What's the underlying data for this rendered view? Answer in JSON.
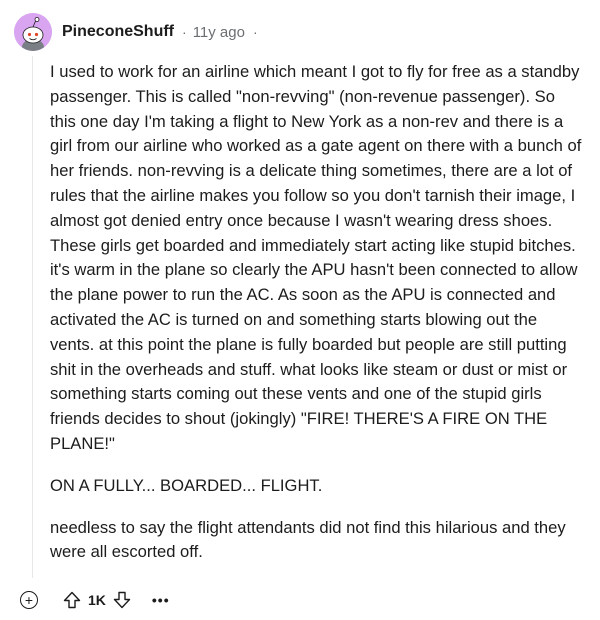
{
  "comment": {
    "author": "PineconeShuff",
    "separator": "·",
    "age": "11y ago",
    "age_suffix": "·",
    "paragraphs": [
      "I used to work for an airline which meant I got to fly for free as a standby passenger. This is called \"non-revving\" (non-revenue passenger). So this one day I'm taking a flight to New York as a non-rev and there is a girl from our airline who worked as a gate agent on there with a bunch of her friends. non-revving is a delicate thing sometimes, there are a lot of rules that the airline makes you follow so you don't tarnish their image, I almost got denied entry once because I wasn't wearing dress shoes. These girls get boarded and immediately start acting like stupid bitches. it's warm in the plane so clearly the APU hasn't been connected to allow the plane power to run the AC. As soon as the APU is connected and activated the AC is turned on and something starts blowing out the vents. at this point the plane is fully boarded but people are still putting shit in the overheads and stuff. what looks like steam or dust or mist or something starts coming out these vents and one of the stupid girls friends decides to shout (jokingly) \"FIRE! THERE'S A FIRE ON THE PLANE!\"",
      "ON A FULLY... BOARDED... FLIGHT.",
      "needless to say the flight attendants did not find this hilarious and they were all escorted off."
    ],
    "actions": {
      "expand_label": "+",
      "score": "1K",
      "more_label": "•••"
    },
    "icons": {
      "avatar": "snoo-avatar-icon",
      "expand": "plus-circle-icon",
      "upvote": "arrow-up-icon",
      "downvote": "arrow-down-icon",
      "more": "ellipsis-icon"
    },
    "colors": {
      "avatar_bg": "#d9a4f0",
      "meta_text": "#6b6f72",
      "text": "#1c1c1c"
    }
  }
}
